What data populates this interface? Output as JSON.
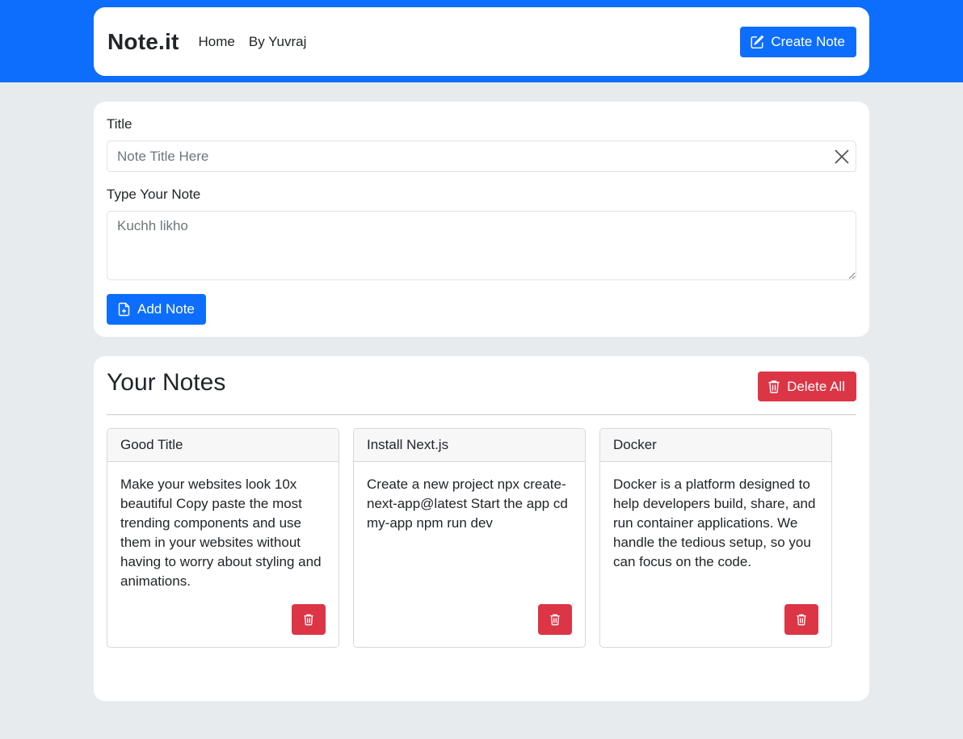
{
  "navbar": {
    "brand": "Note.it",
    "links": [
      "Home",
      "By Yuvraj"
    ],
    "create_label": "Create Note"
  },
  "form": {
    "title_label": "Title",
    "title_placeholder": "Note Title Here",
    "note_label": "Type Your Note",
    "note_placeholder": "Kuchh likho",
    "add_label": "Add Note"
  },
  "notes_section": {
    "heading": "Your Notes",
    "delete_all_label": "Delete All",
    "notes": [
      {
        "title": "Good Title",
        "body": "Make your websites look 10x beautiful Copy paste the most trending components and use them in your websites without having to worry about styling and animations."
      },
      {
        "title": "Install Next.js",
        "body": "Create a new project npx create-next-app@latest Start the app cd my-app npm run dev"
      },
      {
        "title": "Docker",
        "body": "Docker is a platform designed to help developers build, share, and run container applications. We handle the tedious setup, so you can focus on the code."
      }
    ]
  },
  "colors": {
    "primary": "#0d6efd",
    "danger": "#dc3545",
    "background": "#e8ebee"
  },
  "icons": {
    "create": "pencil-square-icon",
    "clear": "close-icon",
    "add": "file-plus-icon",
    "delete": "trash-icon"
  }
}
